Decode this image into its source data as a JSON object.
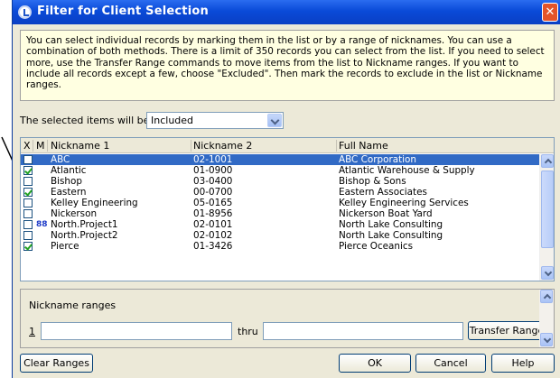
{
  "window": {
    "title": "Filter for Client Selection",
    "close_glyph": "✕"
  },
  "info_text": "You can select individual records by marking them in the list or by a range of nicknames. You can use a combination of both methods. There is a limit of 350 records you can select from the list. If you need to select more, use the Transfer Range commands to move items from the list to Nickname ranges. If you want to include all records except a few, choose \"Excluded\". Then mark the records to exclude in the list or Nickname ranges.",
  "selected_items": {
    "label": "The selected items will be",
    "value": "Included"
  },
  "list": {
    "headers": [
      "X",
      "M",
      "Nickname 1",
      "Nickname 2",
      "Full Name"
    ],
    "rows": [
      {
        "checked": false,
        "mark": "",
        "nick1": "ABC",
        "nick2": "02-1001",
        "full": "ABC Corporation",
        "selected": true
      },
      {
        "checked": true,
        "mark": "",
        "nick1": "Atlantic",
        "nick2": "01-0900",
        "full": "Atlantic Warehouse & Supply",
        "selected": false
      },
      {
        "checked": false,
        "mark": "",
        "nick1": "Bishop",
        "nick2": "03-0400",
        "full": "Bishop & Sons",
        "selected": false
      },
      {
        "checked": true,
        "mark": "",
        "nick1": "Eastern",
        "nick2": "00-0700",
        "full": "Eastern Associates",
        "selected": false
      },
      {
        "checked": false,
        "mark": "",
        "nick1": "Kelley Engineering",
        "nick2": "05-0165",
        "full": "Kelley Engineering Services",
        "selected": false
      },
      {
        "checked": false,
        "mark": "",
        "nick1": "Nickerson",
        "nick2": "01-8956",
        "full": "Nickerson Boat Yard",
        "selected": false
      },
      {
        "checked": false,
        "mark": "88",
        "nick1": "North.Project1",
        "nick2": "02-0101",
        "full": "North Lake Consulting",
        "selected": false
      },
      {
        "checked": false,
        "mark": "",
        "nick1": "North.Project2",
        "nick2": "02-0102",
        "full": "North Lake Consulting",
        "selected": false
      },
      {
        "checked": true,
        "mark": "",
        "nick1": "Pierce",
        "nick2": "01-3426",
        "full": "Pierce Oceanics",
        "selected": false
      }
    ]
  },
  "ranges": {
    "label": "Nickname ranges",
    "row_number": "1",
    "from_value": "",
    "thru_label": "thru",
    "to_value": "",
    "transfer_button": "Transfer Range"
  },
  "buttons": {
    "clear": "Clear Ranges",
    "ok": "OK",
    "cancel": "Cancel",
    "help": "Help"
  },
  "colors": {
    "title_bar": "#0a4ad8",
    "selection": "#316ac5",
    "info_bg": "#ffffe1",
    "dialog_bg": "#ece9d8"
  }
}
